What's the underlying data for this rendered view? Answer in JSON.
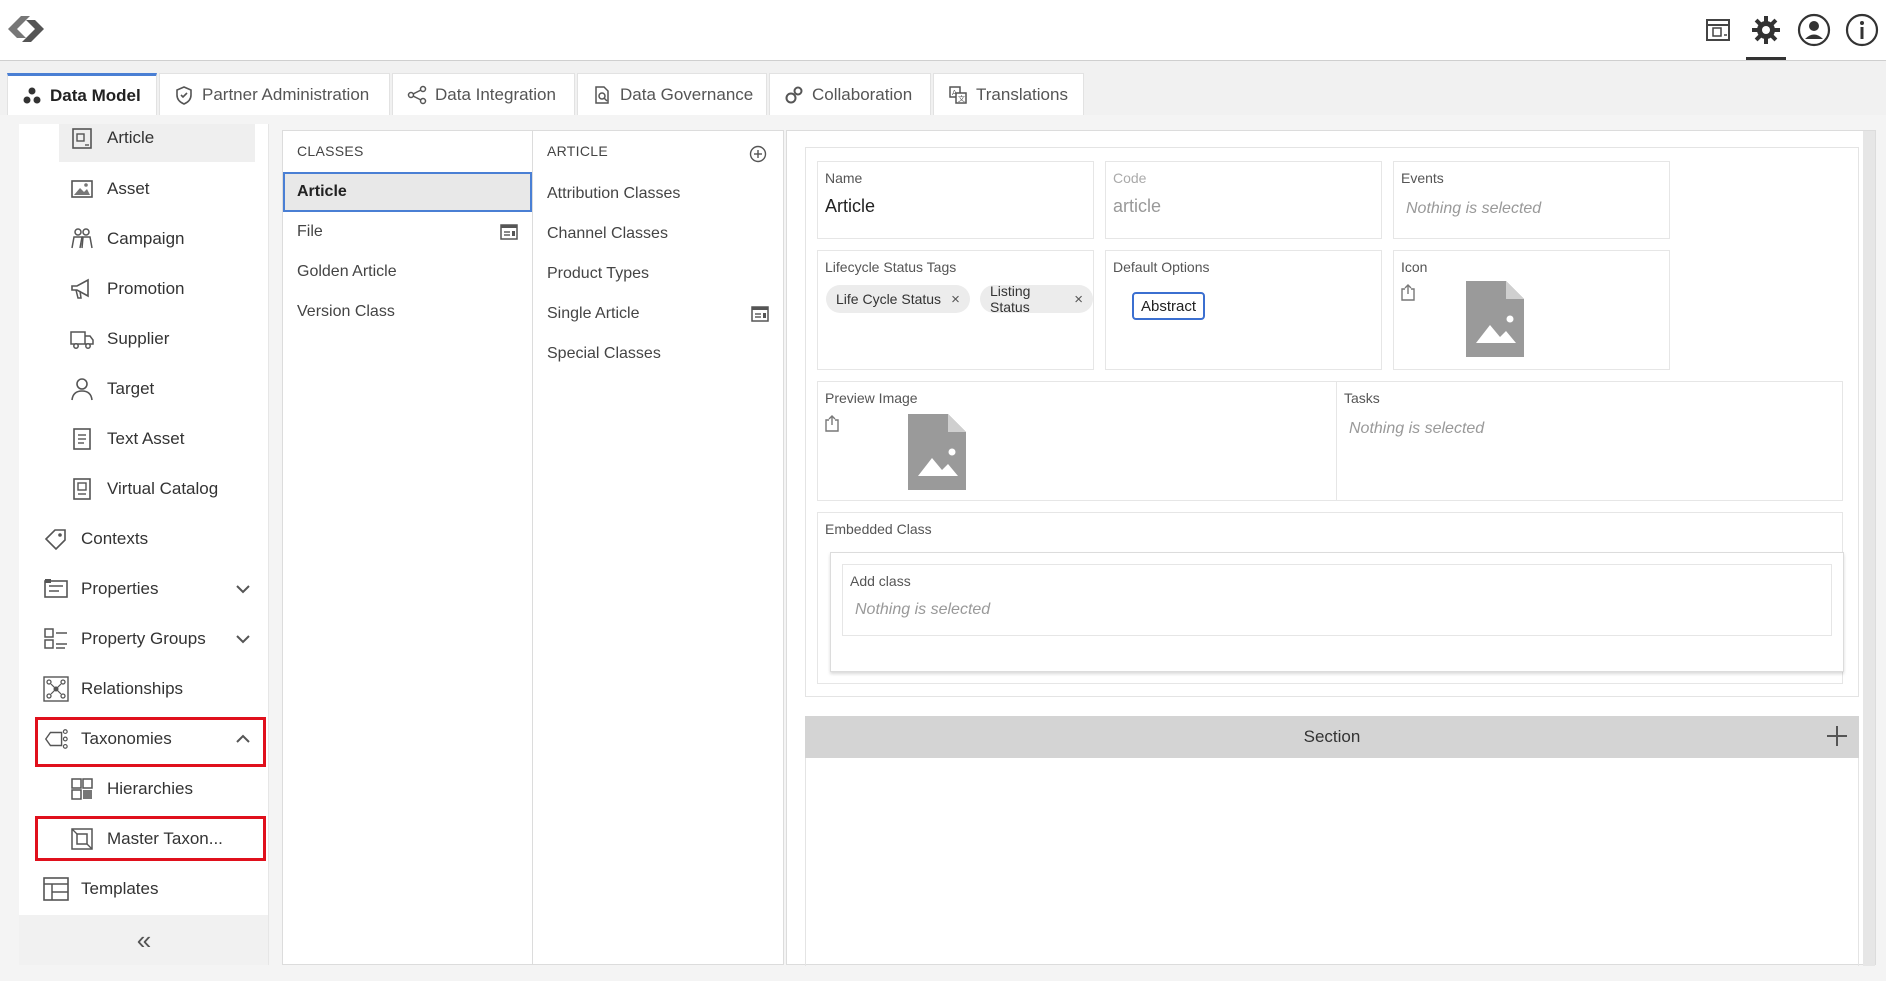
{
  "topbar": {
    "icons": [
      "calendar-clock-icon",
      "gear-icon",
      "user-icon",
      "info-icon"
    ]
  },
  "tabs": [
    {
      "label": "Data Model",
      "icon": "data-model-icon",
      "active": true
    },
    {
      "label": "Partner Administration",
      "icon": "shield-icon",
      "active": false
    },
    {
      "label": "Data Integration",
      "icon": "share-icon",
      "active": false
    },
    {
      "label": "Data Governance",
      "icon": "doc-search-icon",
      "active": false
    },
    {
      "label": "Collaboration",
      "icon": "gears-icon",
      "active": false
    },
    {
      "label": "Translations",
      "icon": "translate-icon",
      "active": false
    }
  ],
  "sidebar": {
    "items": [
      {
        "label": "Article",
        "icon": "article-icon",
        "selected": true
      },
      {
        "label": "Asset",
        "icon": "image-icon"
      },
      {
        "label": "Campaign",
        "icon": "campaign-icon"
      },
      {
        "label": "Promotion",
        "icon": "megaphone-icon"
      },
      {
        "label": "Supplier",
        "icon": "truck-icon"
      },
      {
        "label": "Target",
        "icon": "person-icon"
      },
      {
        "label": "Text Asset",
        "icon": "text-doc-icon"
      },
      {
        "label": "Virtual Catalog",
        "icon": "catalog-icon"
      },
      {
        "label": "Contexts",
        "icon": "tag-icon"
      },
      {
        "label": "Properties",
        "icon": "properties-icon",
        "chevron": "down"
      },
      {
        "label": "Property Groups",
        "icon": "property-groups-icon",
        "chevron": "down"
      },
      {
        "label": "Relationships",
        "icon": "relationships-icon"
      },
      {
        "label": "Taxonomies",
        "icon": "taxonomy-icon",
        "chevron": "up"
      },
      {
        "label": "Hierarchies",
        "icon": "hierarchy-icon"
      },
      {
        "label": "Master Taxon...",
        "icon": "master-taxonomy-icon"
      },
      {
        "label": "Templates",
        "icon": "templates-icon"
      }
    ],
    "collapse_icon": "double-chevron-left-icon"
  },
  "classes_panel": {
    "header": "CLASSES",
    "items": [
      {
        "label": "Article",
        "selected": true
      },
      {
        "label": "File",
        "icon": "form-icon"
      },
      {
        "label": "Golden Article"
      },
      {
        "label": "Version Class"
      }
    ]
  },
  "article_panel": {
    "header": "ARTICLE",
    "add_icon": "add-circle-icon",
    "items": [
      {
        "label": "Attribution Classes"
      },
      {
        "label": "Channel Classes"
      },
      {
        "label": "Product Types"
      },
      {
        "label": "Single Article",
        "icon": "form-icon"
      },
      {
        "label": "Special Classes"
      }
    ]
  },
  "detail": {
    "name_label": "Name",
    "name_value": "Article",
    "code_label": "Code",
    "code_value": "article",
    "events_label": "Events",
    "events_value": "Nothing is selected",
    "lifecycle_label": "Lifecycle Status Tags",
    "lifecycle_tags": [
      "Life Cycle Status",
      "Listing Status"
    ],
    "default_options_label": "Default Options",
    "default_option": "Abstract",
    "icon_label": "Icon",
    "preview_label": "Preview Image",
    "tasks_label": "Tasks",
    "tasks_value": "Nothing is selected",
    "embedded_label": "Embedded Class",
    "add_class_label": "Add class",
    "add_class_value": "Nothing is selected",
    "section_title": "Section",
    "remove_symbol": "×"
  }
}
